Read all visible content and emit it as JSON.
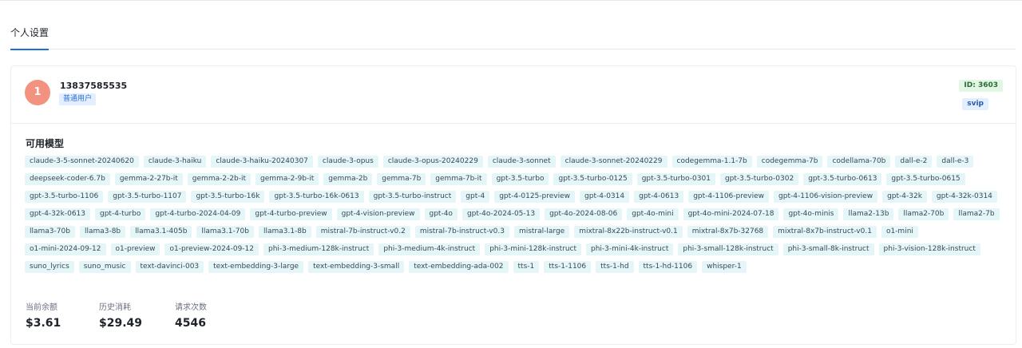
{
  "tabs": [
    {
      "label": "个人设置",
      "active": true
    }
  ],
  "profile": {
    "avatar_letter": "1",
    "username": "13837585535",
    "role": "普通用户",
    "id_badge": "ID: 3603",
    "vip_badge": "svip"
  },
  "models": {
    "title": "可用模型",
    "items": [
      "claude-3-5-sonnet-20240620",
      "claude-3-haiku",
      "claude-3-haiku-20240307",
      "claude-3-opus",
      "claude-3-opus-20240229",
      "claude-3-sonnet",
      "claude-3-sonnet-20240229",
      "codegemma-1.1-7b",
      "codegemma-7b",
      "codellama-70b",
      "dall-e-2",
      "dall-e-3",
      "deepseek-coder-6.7b",
      "gemma-2-27b-it",
      "gemma-2-2b-it",
      "gemma-2-9b-it",
      "gemma-2b",
      "gemma-7b",
      "gemma-7b-it",
      "gpt-3.5-turbo",
      "gpt-3.5-turbo-0125",
      "gpt-3.5-turbo-0301",
      "gpt-3.5-turbo-0302",
      "gpt-3.5-turbo-0613",
      "gpt-3.5-turbo-0615",
      "gpt-3.5-turbo-1106",
      "gpt-3.5-turbo-1107",
      "gpt-3.5-turbo-16k",
      "gpt-3.5-turbo-16k-0613",
      "gpt-3.5-turbo-instruct",
      "gpt-4",
      "gpt-4-0125-preview",
      "gpt-4-0314",
      "gpt-4-0613",
      "gpt-4-1106-preview",
      "gpt-4-1106-vision-preview",
      "gpt-4-32k",
      "gpt-4-32k-0314",
      "gpt-4-32k-0613",
      "gpt-4-turbo",
      "gpt-4-turbo-2024-04-09",
      "gpt-4-turbo-preview",
      "gpt-4-vision-preview",
      "gpt-4o",
      "gpt-4o-2024-05-13",
      "gpt-4o-2024-08-06",
      "gpt-4o-mini",
      "gpt-4o-mini-2024-07-18",
      "gpt-4o-minis",
      "llama2-13b",
      "llama2-70b",
      "llama2-7b",
      "llama3-70b",
      "llama3-8b",
      "llama3.1-405b",
      "llama3.1-70b",
      "llama3.1-8b",
      "mistral-7b-instruct-v0.2",
      "mistral-7b-instruct-v0.3",
      "mistral-large",
      "mixtral-8x22b-instruct-v0.1",
      "mixtral-8x7b-32768",
      "mixtral-8x7b-instruct-v0.1",
      "o1-mini",
      "o1-mini-2024-09-12",
      "o1-preview",
      "o1-preview-2024-09-12",
      "phi-3-medium-128k-instruct",
      "phi-3-medium-4k-instruct",
      "phi-3-mini-128k-instruct",
      "phi-3-mini-4k-instruct",
      "phi-3-small-128k-instruct",
      "phi-3-small-8k-instruct",
      "phi-3-vision-128k-instruct",
      "suno_lyrics",
      "suno_music",
      "text-davinci-003",
      "text-embedding-3-large",
      "text-embedding-3-small",
      "text-embedding-ada-002",
      "tts-1",
      "tts-1-1106",
      "tts-1-hd",
      "tts-1-hd-1106",
      "whisper-1"
    ]
  },
  "stats": {
    "balance_label": "当前余额",
    "balance_value": "$3.61",
    "spent_label": "历史消耗",
    "spent_value": "$29.49",
    "requests_label": "请求次数",
    "requests_value": "4546"
  },
  "colors": {
    "accent": "#1a6fe0",
    "avatar_bg": "#f3927f",
    "tag_bg": "#e4f6f7",
    "id_badge_bg": "#e2f6e4",
    "role_badge_bg": "#e3efff"
  }
}
